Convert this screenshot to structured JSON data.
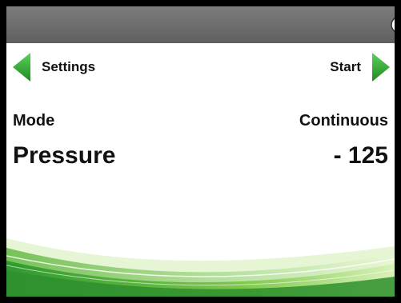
{
  "header": {
    "status_icons": [
      "clock-icon",
      "refresh-icon",
      "battery-icon"
    ],
    "background_color": "#6e6e6e"
  },
  "nav": {
    "back_label": "Settings",
    "forward_label": "Start",
    "arrow_color": "#2fa02f"
  },
  "settings": {
    "mode_label": "Mode",
    "mode_value": "Continuous",
    "pressure_label": "Pressure",
    "pressure_value": "- 125"
  },
  "theme": {
    "accent": "#3aa83a",
    "swoosh_light": "#c8eba0"
  }
}
